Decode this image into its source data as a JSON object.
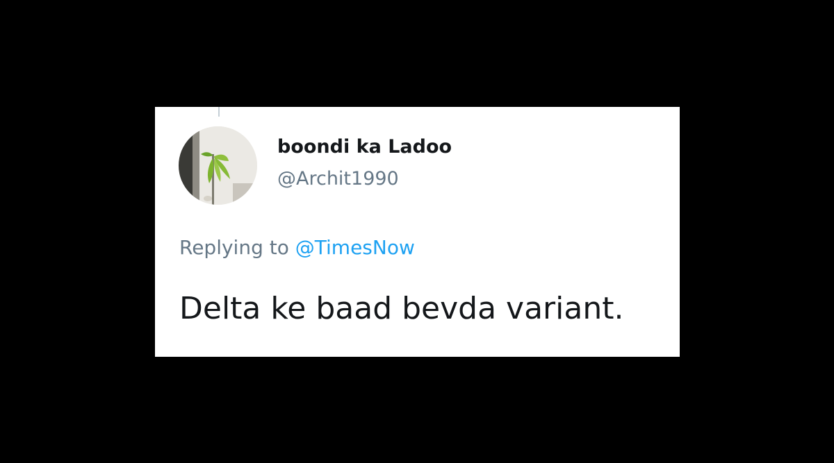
{
  "tweet": {
    "display_name": "boondi ka Ladoo",
    "handle": "@Archit1990",
    "replying_to_prefix": "Replying to",
    "replying_to_mention": "@TimesNow",
    "text": "Delta ke baad bevda variant.",
    "avatar_icon": "plant-sapling-photo"
  },
  "colors": {
    "background": "#000000",
    "card": "#ffffff",
    "text_primary": "#14171a",
    "text_secondary": "#657786",
    "link": "#1da1f2"
  }
}
